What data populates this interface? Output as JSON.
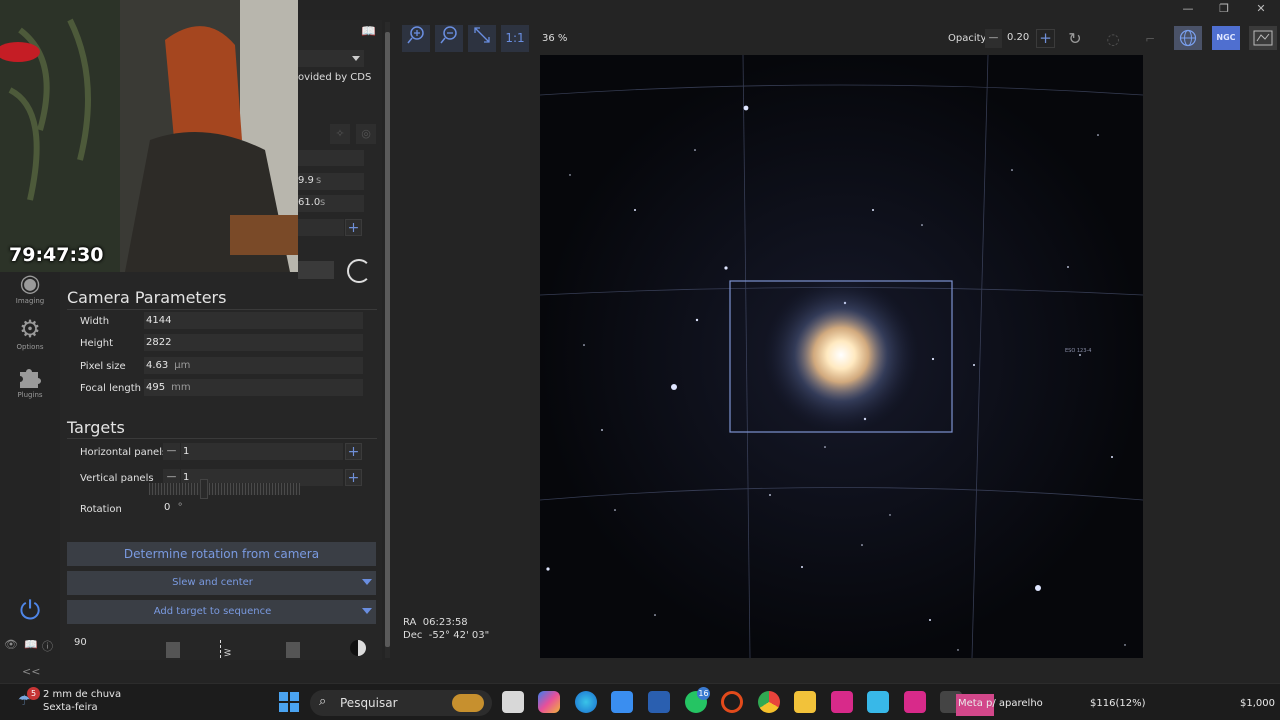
{
  "toolbar": {
    "zoom_level": "36 %",
    "one_to_one": "1:1",
    "opacity_label": "Opacity",
    "opacity_value": "0.20",
    "ngc_label": "NGC"
  },
  "panel": {
    "top": {
      "provided_by": "ovided by CDS",
      "value_a": "9.9",
      "value_a_unit": "s",
      "value_b": "61.0",
      "value_b_unit": "s"
    },
    "camera": {
      "title": "Camera Parameters",
      "width_label": "Width",
      "width_value": "4144",
      "height_label": "Height",
      "height_value": "2822",
      "pixel_label": "Pixel size",
      "pixel_value": "4.63",
      "pixel_unit": "µm",
      "focal_label": "Focal length",
      "focal_value": "495",
      "focal_unit": "mm"
    },
    "targets": {
      "title": "Targets",
      "hpanels_label": "Horizontal panels",
      "hpanels_value": "1",
      "vpanels_label": "Vertical panels",
      "vpanels_value": "1",
      "rotation_label": "Rotation",
      "rotation_value": "0",
      "rotation_unit": "°"
    },
    "buttons": {
      "determine_rotation": "Determine rotation from camera",
      "slew_center": "Slew and center",
      "add_target": "Add target to sequence"
    },
    "bottom_value": "90",
    "bottom_dir": "W",
    "collapse": "<<"
  },
  "rail": {
    "imaging": "Imaging",
    "options": "Options",
    "plugins": "Plugins"
  },
  "sky": {
    "ra_label": "RA",
    "ra_value": "06:23:58",
    "dec_label": "Dec",
    "dec_value": "-52° 42' 03\"",
    "object_label": "ESO 123-4"
  },
  "webcam": {
    "timer": "79:47:30"
  },
  "taskbar": {
    "weather_text": "2 mm de chuva",
    "weather_day": "Sexta-feira",
    "weather_badge": "5",
    "search_text": "Pesquisar",
    "whatsapp_badge": "16",
    "meta_text": "Meta p/ aparelho",
    "money_text": "$116(12%)",
    "money_total": "$1,000"
  }
}
